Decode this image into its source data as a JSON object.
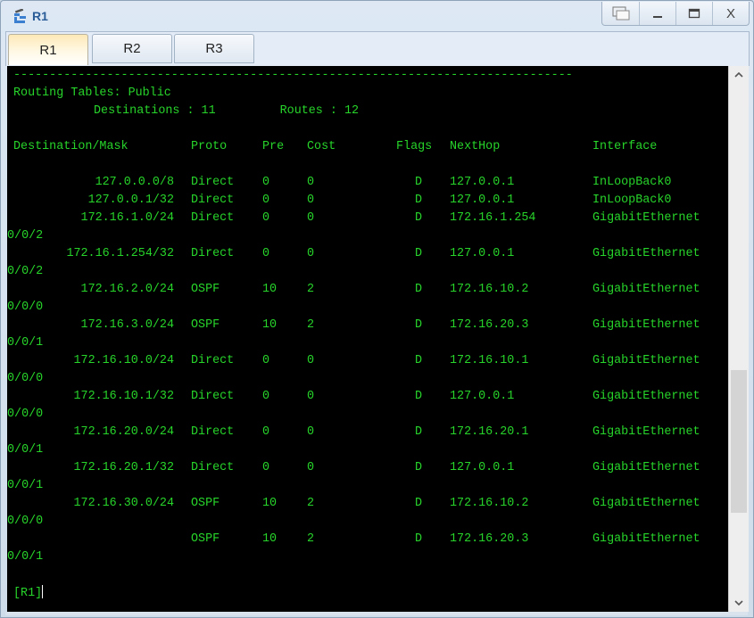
{
  "window": {
    "title": "R1",
    "icon": "router-network-icon",
    "buttons": [
      {
        "name": "restore-windows-button",
        "icon": "cascade-windows-icon"
      },
      {
        "name": "minimize-button",
        "icon": "minimize-icon"
      },
      {
        "name": "maximize-button",
        "icon": "maximize-icon"
      },
      {
        "name": "close-button",
        "label": "X",
        "icon": "close-icon"
      }
    ]
  },
  "tabs": [
    {
      "label": "R1",
      "active": true
    },
    {
      "label": "R2",
      "active": false
    },
    {
      "label": "R3",
      "active": false
    }
  ],
  "terminal": {
    "separator": "------------------------------------------------------------------------------",
    "table_title": "Routing Tables: Public",
    "summary": {
      "destinations_label": "Destinations",
      "destinations": "11",
      "routes_label": "Routes",
      "routes": "12"
    },
    "columns": [
      "Destination/Mask",
      "Proto",
      "Pre",
      "Cost",
      "Flags",
      "NextHop",
      "Interface"
    ],
    "routes": [
      {
        "dest": "127.0.0.0/8",
        "proto": "Direct",
        "pre": "0",
        "cost": "0",
        "flags": "D",
        "nexthop": "127.0.0.1",
        "interface": "InLoopBack0",
        "interface_cont": ""
      },
      {
        "dest": "127.0.0.1/32",
        "proto": "Direct",
        "pre": "0",
        "cost": "0",
        "flags": "D",
        "nexthop": "127.0.0.1",
        "interface": "InLoopBack0",
        "interface_cont": ""
      },
      {
        "dest": "172.16.1.0/24",
        "proto": "Direct",
        "pre": "0",
        "cost": "0",
        "flags": "D",
        "nexthop": "172.16.1.254",
        "interface": "GigabitEthernet",
        "interface_cont": "0/0/2"
      },
      {
        "dest": "172.16.1.254/32",
        "proto": "Direct",
        "pre": "0",
        "cost": "0",
        "flags": "D",
        "nexthop": "127.0.0.1",
        "interface": "GigabitEthernet",
        "interface_cont": "0/0/2"
      },
      {
        "dest": "172.16.2.0/24",
        "proto": "OSPF",
        "pre": "10",
        "cost": "2",
        "flags": "D",
        "nexthop": "172.16.10.2",
        "interface": "GigabitEthernet",
        "interface_cont": "0/0/0"
      },
      {
        "dest": "172.16.3.0/24",
        "proto": "OSPF",
        "pre": "10",
        "cost": "2",
        "flags": "D",
        "nexthop": "172.16.20.3",
        "interface": "GigabitEthernet",
        "interface_cont": "0/0/1"
      },
      {
        "dest": "172.16.10.0/24",
        "proto": "Direct",
        "pre": "0",
        "cost": "0",
        "flags": "D",
        "nexthop": "172.16.10.1",
        "interface": "GigabitEthernet",
        "interface_cont": "0/0/0"
      },
      {
        "dest": "172.16.10.1/32",
        "proto": "Direct",
        "pre": "0",
        "cost": "0",
        "flags": "D",
        "nexthop": "127.0.0.1",
        "interface": "GigabitEthernet",
        "interface_cont": "0/0/0"
      },
      {
        "dest": "172.16.20.0/24",
        "proto": "Direct",
        "pre": "0",
        "cost": "0",
        "flags": "D",
        "nexthop": "172.16.20.1",
        "interface": "GigabitEthernet",
        "interface_cont": "0/0/1"
      },
      {
        "dest": "172.16.20.1/32",
        "proto": "Direct",
        "pre": "0",
        "cost": "0",
        "flags": "D",
        "nexthop": "127.0.0.1",
        "interface": "GigabitEthernet",
        "interface_cont": "0/0/1"
      },
      {
        "dest": "172.16.30.0/24",
        "proto": "OSPF",
        "pre": "10",
        "cost": "2",
        "flags": "D",
        "nexthop": "172.16.10.2",
        "interface": "GigabitEthernet",
        "interface_cont": "0/0/0"
      },
      {
        "dest": "",
        "proto": "OSPF",
        "pre": "10",
        "cost": "2",
        "flags": "D",
        "nexthop": "172.16.20.3",
        "interface": "GigabitEthernet",
        "interface_cont": "0/0/1"
      }
    ],
    "prompt": "[R1]",
    "text_color": "#27d42a",
    "background_color": "#000000"
  },
  "scrollbar": {
    "position_fraction": 0.78,
    "visible_fraction": 0.28,
    "up_arrow": "^",
    "down_arrow": "v"
  }
}
